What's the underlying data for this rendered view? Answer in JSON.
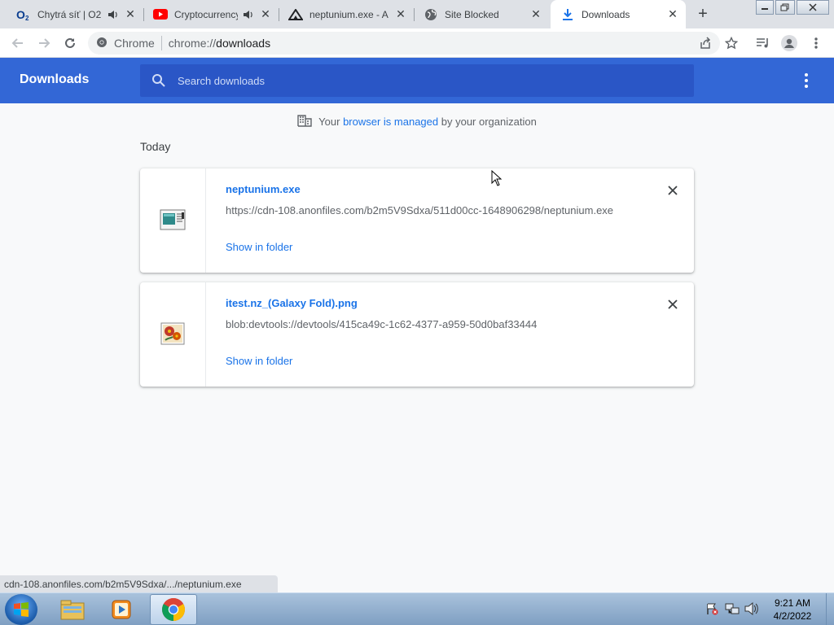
{
  "tabs": [
    {
      "title": "Chytrá síť | O2",
      "favicon": "o2-icon"
    },
    {
      "title": "Cryptocurrency",
      "favicon": "youtube-icon"
    },
    {
      "title": "neptunium.exe - A",
      "favicon": "anon-icon"
    },
    {
      "title": "Site Blocked",
      "favicon": "globe-icon"
    },
    {
      "title": "Downloads",
      "favicon": "download-icon"
    }
  ],
  "toolbar": {
    "scheme_label": "Chrome",
    "url_host": "chrome://",
    "url_path": "downloads"
  },
  "header": {
    "title": "Downloads",
    "search_placeholder": "Search downloads"
  },
  "managed": {
    "prefix": "Your",
    "link": "browser is managed",
    "suffix": "by your organization"
  },
  "section": {
    "label": "Today"
  },
  "downloads": [
    {
      "file_name": "neptunium.exe",
      "url": "https://cdn-108.anonfiles.com/b2m5V9Sdxa/511d00cc-1648906298/neptunium.exe",
      "action": "Show in folder",
      "icon": "exe-file-icon"
    },
    {
      "file_name": "itest.nz_(Galaxy Fold).png",
      "url": "blob:devtools://devtools/415ca49c-1c62-4377-a959-50d0baf33444",
      "action": "Show in folder",
      "icon": "image-file-icon"
    }
  ],
  "status_bubble": "cdn-108.anonfiles.com/b2m5V9Sdxa/.../neptunium.exe",
  "taskbar": {
    "time": "9:21 AM",
    "date": "4/2/2022"
  },
  "colors": {
    "header": "#3367d6",
    "link": "#1a73e8"
  }
}
